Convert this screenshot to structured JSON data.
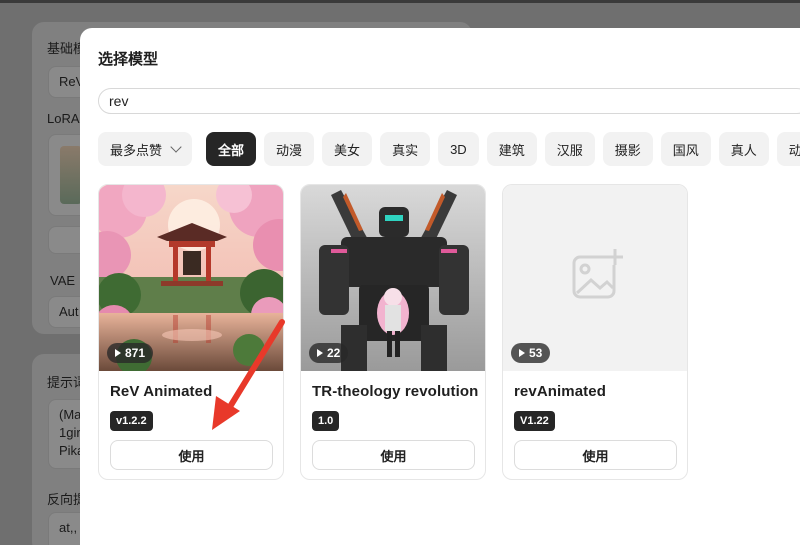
{
  "background": {
    "labels": [
      "基础模",
      "LoRA",
      "VAE",
      "提示词",
      "反向提"
    ],
    "fields": [
      "ReV",
      "Aut",
      "(Ma",
      "1gir",
      "Pika",
      "at,,"
    ]
  },
  "modal": {
    "title": "选择模型",
    "search_value": "rev",
    "sort_label": "最多点赞",
    "categories": [
      "全部",
      "动漫",
      "美女",
      "真实",
      "3D",
      "建筑",
      "汉服",
      "摄影",
      "国风",
      "真人",
      "动物"
    ],
    "active_category": "全部",
    "use_label": "使用",
    "models": [
      {
        "name": "ReV Animated",
        "version": "v1.2.2",
        "count": "871"
      },
      {
        "name": "TR-theology revolution",
        "version": "1.0",
        "count": "22"
      },
      {
        "name": "revAnimated",
        "version": "V1.22",
        "count": "53"
      }
    ]
  },
  "colors": {
    "accent": "#262626",
    "annotation_arrow": "#e8392a"
  }
}
